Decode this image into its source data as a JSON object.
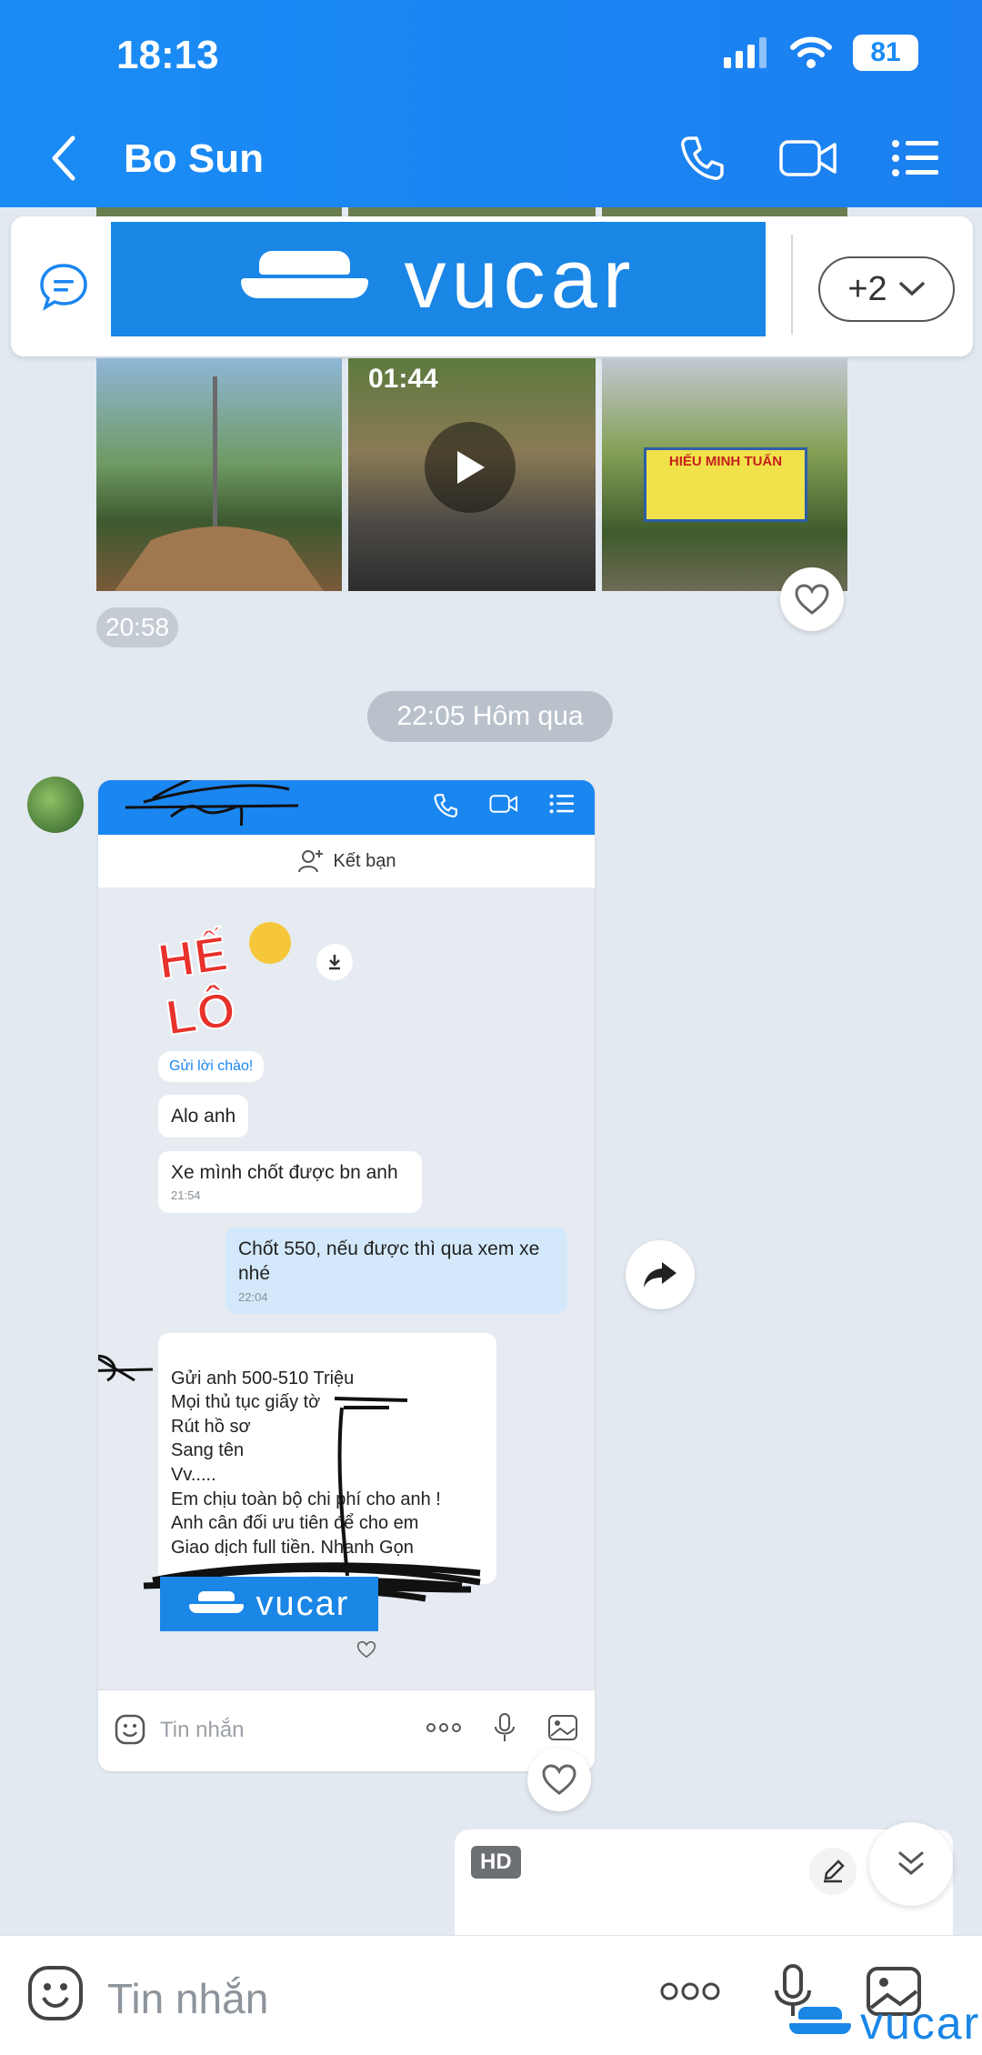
{
  "status_bar": {
    "time": "18:13",
    "battery": "81"
  },
  "header": {
    "title": "Bo Sun"
  },
  "pinned": {
    "brand": "vucar",
    "more_label": "+2"
  },
  "media": {
    "video_duration": "01:44",
    "signboard_text": "HIẾU MINH TUẤN",
    "sent_time": "20:58"
  },
  "date_separator": "22:05 Hôm qua",
  "shared_screenshot": {
    "add_friend": "Kết bạn",
    "greeting_chip": "Gửi lời chào!",
    "sticker_text": "HẾ LÔ",
    "messages": [
      {
        "text": "Alo anh",
        "time": ""
      },
      {
        "text": "Xe mình chốt được bn anh",
        "time": "21:54"
      },
      {
        "text": "Chốt 550, nếu được thì qua xem xe nhé",
        "time": "22:04"
      }
    ],
    "long_message": "Gửi anh 500-510 Triệu\nMọi thủ tục giấy tờ\nRút hồ sơ\nSang tên\nVv.....\nEm chịu toàn bộ chi phí cho anh !\nAnh cân đối ưu tiên để cho em\nGiao dịch full tiền. Nhanh Gọn",
    "brand": "vucar",
    "input_placeholder": "Tin nhắn"
  },
  "partial_card": {
    "badge": "HD"
  },
  "composer": {
    "placeholder": "Tin nhắn"
  },
  "watermark": {
    "brand": "vucar"
  }
}
